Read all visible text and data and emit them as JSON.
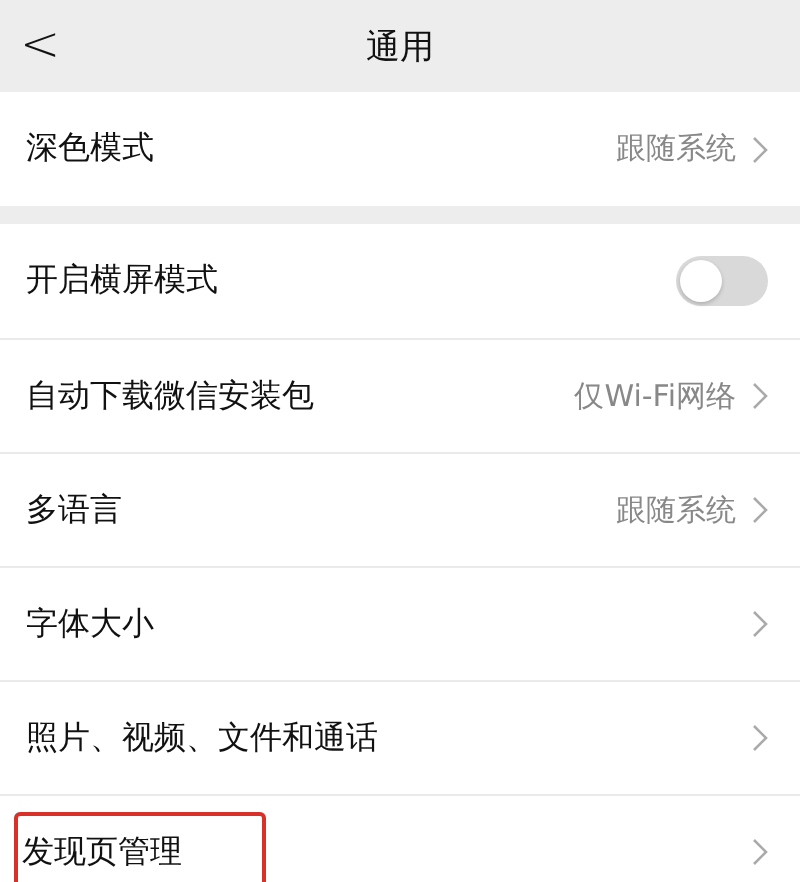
{
  "header": {
    "back": "<",
    "title": "通用"
  },
  "groups": [
    {
      "items": [
        {
          "kind": "link",
          "label": "深色模式",
          "value": "跟随系统",
          "highlighted": false
        }
      ]
    },
    {
      "items": [
        {
          "kind": "toggle",
          "label": "开启横屏模式",
          "on": false,
          "highlighted": false
        },
        {
          "kind": "link",
          "label": "自动下载微信安装包",
          "value": "仅Wi-Fi网络",
          "highlighted": false
        },
        {
          "kind": "link",
          "label": "多语言",
          "value": "跟随系统",
          "highlighted": false
        },
        {
          "kind": "link",
          "label": "字体大小",
          "highlighted": false
        },
        {
          "kind": "link",
          "label": "照片、视频、文件和通话",
          "highlighted": false
        },
        {
          "kind": "link",
          "label": "发现页管理",
          "highlighted": true
        }
      ]
    }
  ]
}
